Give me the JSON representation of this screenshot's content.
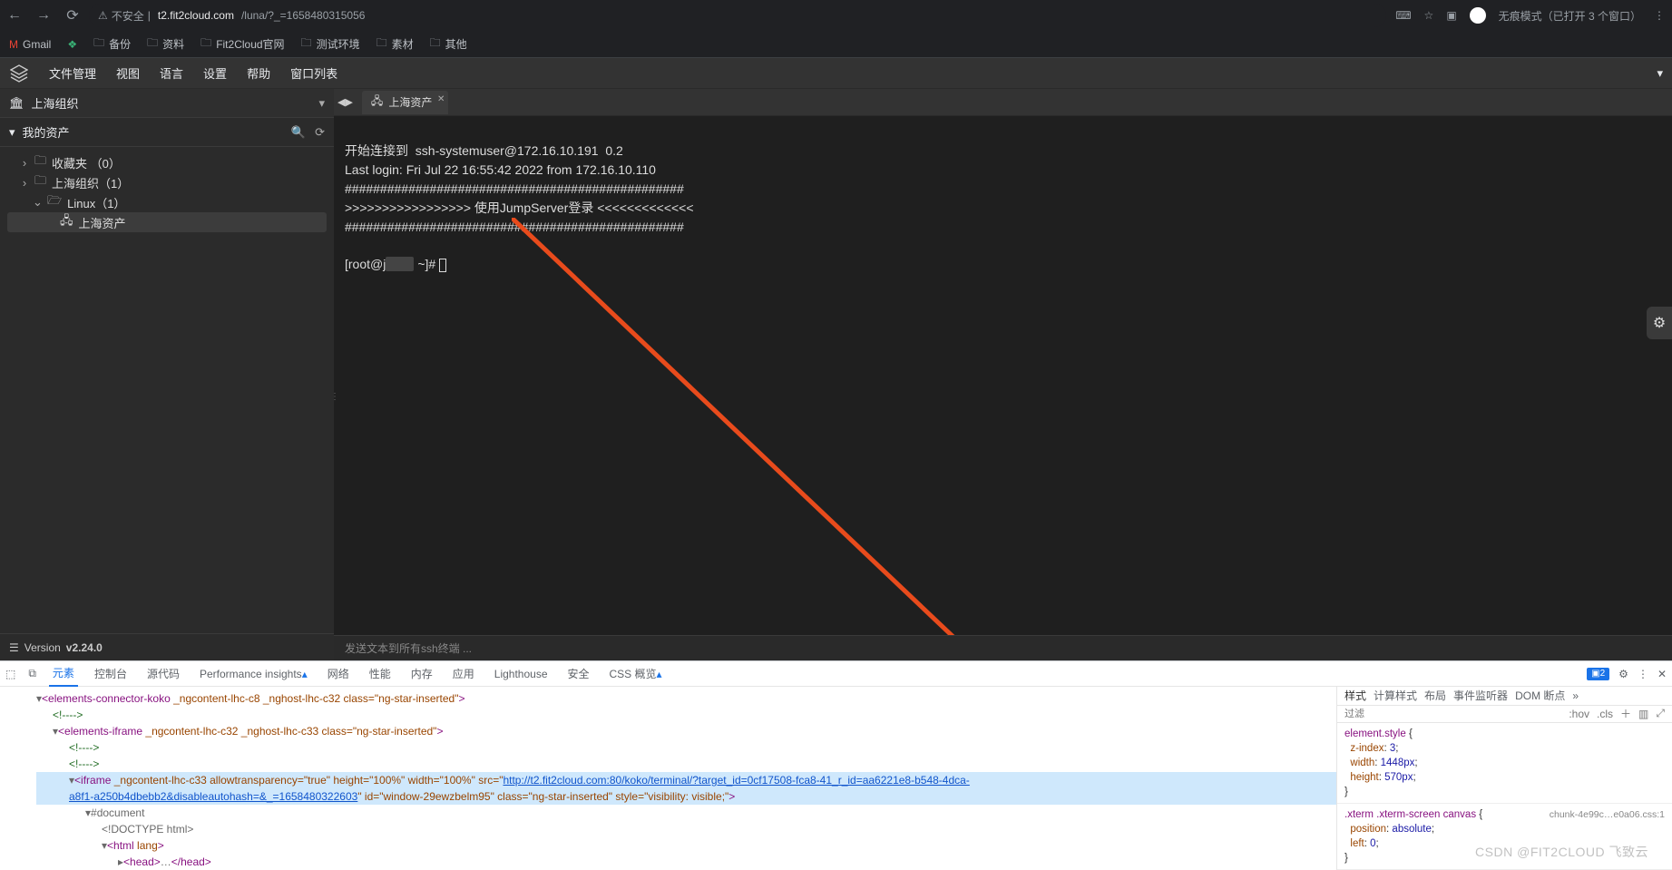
{
  "browser": {
    "insecure_label": "不安全",
    "url_host": "t2.fit2cloud.com",
    "url_path": "/luna/?_=1658480315056",
    "incognito_label": "无痕模式（已打开 3 个窗口）"
  },
  "bookmarks": [
    {
      "icon": "gmail",
      "label": "Gmail"
    },
    {
      "icon": "green",
      "label": ""
    },
    {
      "icon": "folder",
      "label": "备份"
    },
    {
      "icon": "folder",
      "label": "资料"
    },
    {
      "icon": "folder",
      "label": "Fit2Cloud官网"
    },
    {
      "icon": "folder",
      "label": "测试环境"
    },
    {
      "icon": "folder",
      "label": "素材"
    },
    {
      "icon": "folder",
      "label": "其他"
    }
  ],
  "topmenu": [
    "文件管理",
    "视图",
    "语言",
    "设置",
    "帮助",
    "窗口列表"
  ],
  "sidebar": {
    "org_label": "上海组织",
    "my_assets_label": "我的资产",
    "tree": [
      {
        "level": 1,
        "caret": ">",
        "icon": "folder",
        "label": "收藏夹 （0）"
      },
      {
        "level": 1,
        "caret": ">",
        "icon": "folder",
        "label": "上海组织（1）"
      },
      {
        "level": 2,
        "caret": "v",
        "icon": "folder",
        "label": "Linux（1）"
      },
      {
        "level": 3,
        "caret": "",
        "icon": "host",
        "label": "上海资产",
        "selected": true
      }
    ],
    "version_label": "Version ",
    "version_value": "v2.24.0"
  },
  "tabs": {
    "active_label": "上海资产"
  },
  "terminal": {
    "lines": [
      "开始连接到  ssh-systemuser@172.16.10.191  0.2",
      "Last login: Fri Jul 22 16:55:42 2022 from 172.16.10.110",
      "################################################",
      ">>>>>>>>>>>>>>>>> 使用JumpServer登录 <<<<<<<<<<<<<",
      "################################################"
    ],
    "prompt_prefix": "[root@j",
    "prompt_blur": "        ",
    "prompt_suffix": " ~]# "
  },
  "sendbar_placeholder": "发送文本到所有ssh终端 ...",
  "devtools": {
    "tabs": [
      "元素",
      "控制台",
      "源代码",
      "Performance insights",
      "网络",
      "性能",
      "内存",
      "应用",
      "Lighthouse",
      "安全",
      "CSS 概览"
    ],
    "issues_count": "2",
    "styles_tabs": [
      "样式",
      "计算样式",
      "布局",
      "事件监听器",
      "DOM 断点"
    ],
    "filter_placeholder": "过滤",
    "hov": ":hov",
    "cls": ".cls",
    "more": "»",
    "elements": {
      "line1_tag": "elements-connector-koko",
      "line1_attrs": " _ngcontent-lhc-c8 _nghost-lhc-c32 class=\"ng-star-inserted\"",
      "line2_tag": "elements-iframe",
      "line2_attrs": " _ngcontent-lhc-c32 _nghost-lhc-c33 class=\"ng-star-inserted\"",
      "iframe_tag": "iframe",
      "iframe_attrs_1": " _ngcontent-lhc-c33 allowtransparency=\"true\" height=\"100%\" width=\"100%\" src=\"",
      "iframe_url": "http://t2.fit2cloud.com:80/koko/terminal/?target_id=0cf17508-fca8-41_r_id=aa6221e8-b548-4dca-",
      "iframe_url2": "a8f1-a250b4dbebb2&disableautohash=&_=1658480322603",
      "iframe_attrs_2": "\" id=\"window-29ewzbelm95\" class=\"ng-star-inserted\" style=\"visibility: visible;\"",
      "document_label": "#document",
      "doctype_label": "<!DOCTYPE html>",
      "html_tag": "html",
      "html_attrs": " lang",
      "head_tag": "head",
      "head_ellipsis": "…",
      "head_close": "</head>"
    },
    "css": {
      "rule1_sel": "element.style",
      "rule1": [
        {
          "p": "z-index",
          "v": "3"
        },
        {
          "p": "width",
          "v": "1448px"
        },
        {
          "p": "height",
          "v": "570px"
        }
      ],
      "rule2_sel": ".xterm .xterm-screen canvas",
      "rule2_src": "chunk-4e99c…e0a06.css:1",
      "rule2": [
        {
          "p": "position",
          "v": "absolute"
        },
        {
          "p": "left",
          "v": "0"
        }
      ]
    }
  },
  "watermark": "CSDN @FIT2CLOUD 飞致云"
}
